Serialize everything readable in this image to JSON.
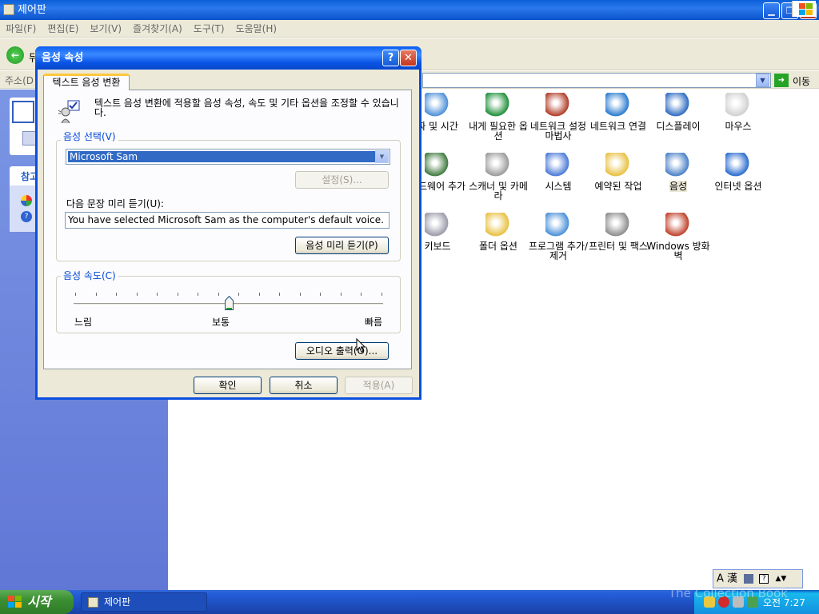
{
  "main_window": {
    "title": "제어판",
    "menu": [
      "파일(F)",
      "편집(E)",
      "보기(V)",
      "즐겨찾기(A)",
      "도구(T)",
      "도움말(H)"
    ],
    "address_label": "주소(D",
    "back_label": "뒤",
    "go_label": "이동"
  },
  "task_pane": {
    "section_title": "참고"
  },
  "icons": [
    {
      "label": "날짜 및 시간",
      "shown": "짜 및 시간",
      "icon": "clock-calendar-icon"
    },
    {
      "label": "내게 필요한 옵션",
      "icon": "accessibility-icon"
    },
    {
      "label": "네트워크 설정 마법사",
      "icon": "network-setup-icon"
    },
    {
      "label": "네트워크 연결",
      "icon": "network-connections-icon"
    },
    {
      "label": "디스플레이",
      "icon": "display-icon"
    },
    {
      "label": "마우스",
      "icon": "mouse-icon"
    },
    {
      "label": "하드웨어 추가",
      "icon": "add-hardware-icon"
    },
    {
      "label": "스캐너 및 카메라",
      "icon": "scanner-camera-icon"
    },
    {
      "label": "시스템",
      "icon": "system-icon"
    },
    {
      "label": "예약된 작업",
      "icon": "scheduled-tasks-icon"
    },
    {
      "label": "음성",
      "icon": "speech-icon"
    },
    {
      "label": "인터넷 옵션",
      "icon": "internet-options-icon"
    },
    {
      "label": "키보드",
      "icon": "keyboard-icon"
    },
    {
      "label": "폴더 옵션",
      "icon": "folder-options-icon"
    },
    {
      "label": "프로그램 추가/제거",
      "icon": "add-remove-programs-icon"
    },
    {
      "label": "프린터 및 팩스",
      "icon": "printers-faxes-icon"
    },
    {
      "label": "Windows 방화벽",
      "icon": "firewall-icon"
    }
  ],
  "dialog": {
    "title": "음성 속성",
    "tab": "텍스트 음성 변환",
    "description": "텍스트 음성 변환에 적용할 음성 속성, 속도 및 기타 옵션을 조정할 수 있습니다.",
    "voice_group": "음성 선택(V)",
    "voice_value": "Microsoft Sam",
    "settings_button": "설정(S)...",
    "preview_label": "다음 문장 미리 듣기(U):",
    "preview_text": "You have selected Microsoft Sam as the computer's default voice.",
    "preview_button": "음성 미리 듣기(P)",
    "speed_group": "음성 속도(C)",
    "speed_slow": "느림",
    "speed_normal": "보통",
    "speed_fast": "빠름",
    "speed_level": 0.5,
    "audio_output_button": "오디오 출력(O)...",
    "ok_button": "확인",
    "cancel_button": "취소",
    "apply_button": "적용(A)"
  },
  "taskbar": {
    "start_label": "시작",
    "task_item": "제어판",
    "clock": "오전 7:27",
    "language_bar": "A 漢"
  },
  "watermark": "The Collection Book",
  "colors": {
    "title_blue": "#0a5fd8",
    "start_green": "#3c8f33",
    "dialog_face": "#ece9d8",
    "selection": "#316ac5"
  }
}
